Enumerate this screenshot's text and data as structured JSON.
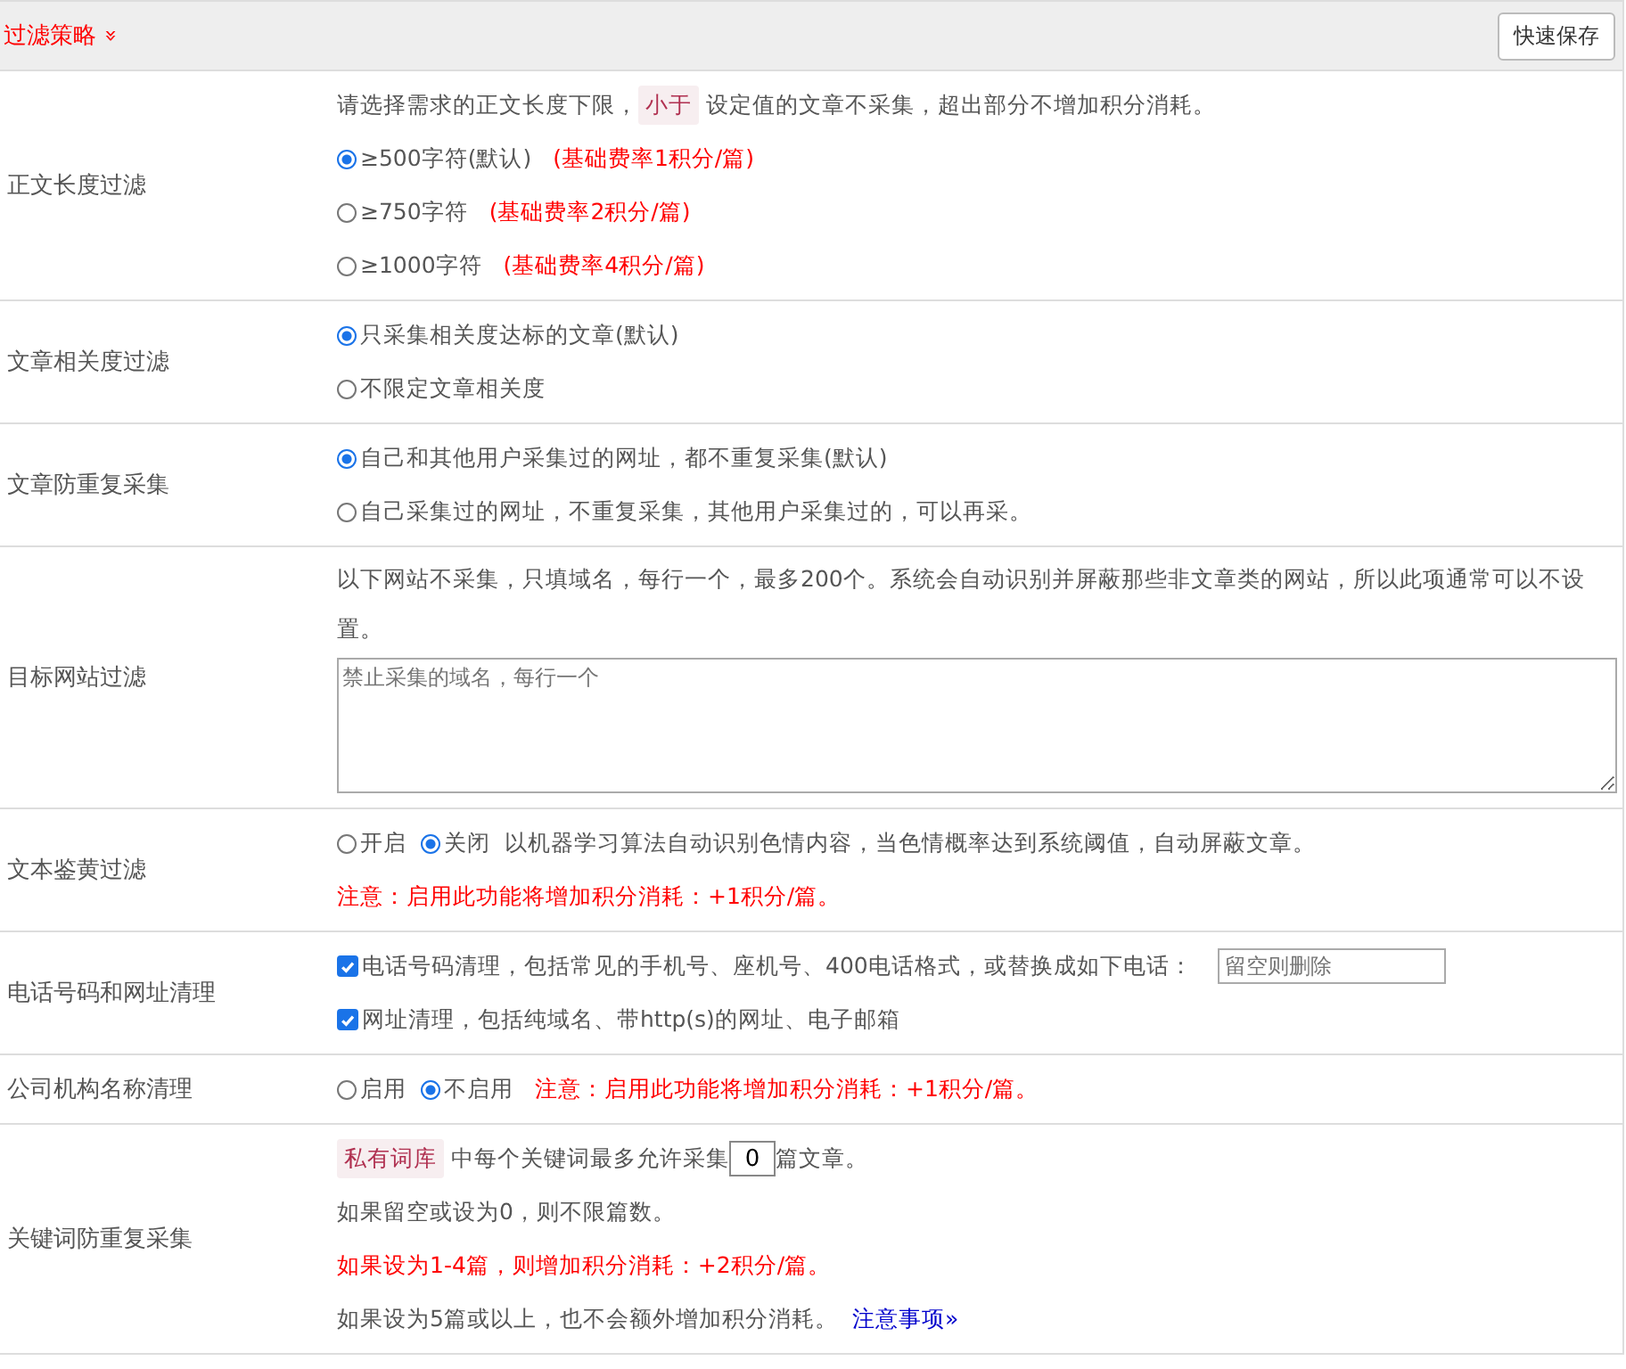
{
  "header": {
    "title": "过滤策略",
    "expand_icon": "»",
    "save_button": "快速保存"
  },
  "rows": [
    {
      "label": "正文长度过滤",
      "lines": [
        [
          {
            "kind": "text",
            "text": "请选择需求的正文长度下限，"
          },
          {
            "kind": "tag",
            "text": "小于"
          },
          {
            "kind": "text",
            "text": "设定值的文章不采集，超出部分不增加积分消耗。"
          }
        ],
        [
          {
            "kind": "radio",
            "text": "≥500字符(默认)",
            "selected": true
          },
          {
            "kind": "note",
            "text": "(基础费率1积分/篇)"
          }
        ],
        [
          {
            "kind": "radio",
            "text": "≥750字符",
            "selected": false
          },
          {
            "kind": "note",
            "text": "(基础费率2积分/篇)"
          }
        ],
        [
          {
            "kind": "radio",
            "text": "≥1000字符",
            "selected": false
          },
          {
            "kind": "note",
            "text": "(基础费率4积分/篇)"
          }
        ]
      ]
    },
    {
      "label": "文章相关度过滤",
      "lines": [
        [
          {
            "kind": "radio",
            "text": "只采集相关度达标的文章(默认)",
            "selected": true
          }
        ],
        [
          {
            "kind": "radio",
            "text": "不限定文章相关度",
            "selected": false
          }
        ]
      ]
    },
    {
      "label": "文章防重复采集",
      "lines": [
        [
          {
            "kind": "radio",
            "text": "自己和其他用户采集过的网址，都不重复采集(默认)",
            "selected": true
          }
        ],
        [
          {
            "kind": "radio",
            "text": "自己采集过的网址，不重复采集，其他用户采集过的，可以再采。",
            "selected": false
          }
        ]
      ]
    },
    {
      "label": "目标网站过滤",
      "lines": [
        [
          {
            "kind": "text",
            "text": "以下网站不采集，只填域名，每行一个，最多200个。系统会自动识别并屏蔽那些非文章类的网站，所以此项通常可以不设置。"
          }
        ],
        [
          {
            "kind": "textarea",
            "placeholder": "禁止采集的域名，每行一个"
          }
        ]
      ]
    },
    {
      "label": "文本鉴黄过滤",
      "lines": [
        [
          {
            "kind": "radio",
            "text": "开启",
            "selected": false
          },
          {
            "kind": "radio",
            "text": "关闭",
            "selected": true
          },
          {
            "kind": "text",
            "text": "以机器学习算法自动识别色情内容，当色情概率达到系统阈值，自动屏蔽文章。"
          }
        ],
        [
          {
            "kind": "note",
            "text": "注意：启用此功能将增加积分消耗：+1积分/篇。"
          }
        ]
      ]
    },
    {
      "label": "电话号码和网址清理",
      "lines": [
        [
          {
            "kind": "checkbox",
            "text": "电话号码清理，包括常见的手机号、座机号、400电话格式，或替换成如下电话：",
            "checked": true
          },
          {
            "kind": "input",
            "placeholder": "留空则删除"
          }
        ],
        [
          {
            "kind": "checkbox",
            "text": "网址清理，包括纯域名、带http(s)的网址、电子邮箱",
            "checked": true
          }
        ]
      ]
    },
    {
      "label": "公司机构名称清理",
      "lines": [
        [
          {
            "kind": "radio",
            "text": "启用",
            "selected": false
          },
          {
            "kind": "radio",
            "text": "不启用",
            "selected": true
          },
          {
            "kind": "note",
            "text": "注意：启用此功能将增加积分消耗：+1积分/篇。"
          }
        ]
      ]
    },
    {
      "label": "关键词防重复采集",
      "lines": [
        [
          {
            "kind": "tag",
            "text": "私有词库"
          },
          {
            "kind": "text",
            "text": "中每个关键词最多允许采集"
          },
          {
            "kind": "number",
            "value": "0"
          },
          {
            "kind": "text",
            "text": "篇文章。"
          }
        ],
        [
          {
            "kind": "text",
            "text": "如果留空或设为0，则不限篇数。"
          }
        ],
        [
          {
            "kind": "note",
            "text": "如果设为1-4篇，则增加积分消耗：+2积分/篇。"
          }
        ],
        [
          {
            "kind": "text",
            "text": "如果设为5篇或以上，也不会额外增加积分消耗。"
          },
          {
            "kind": "link",
            "text": "注意事项»"
          }
        ]
      ]
    }
  ]
}
